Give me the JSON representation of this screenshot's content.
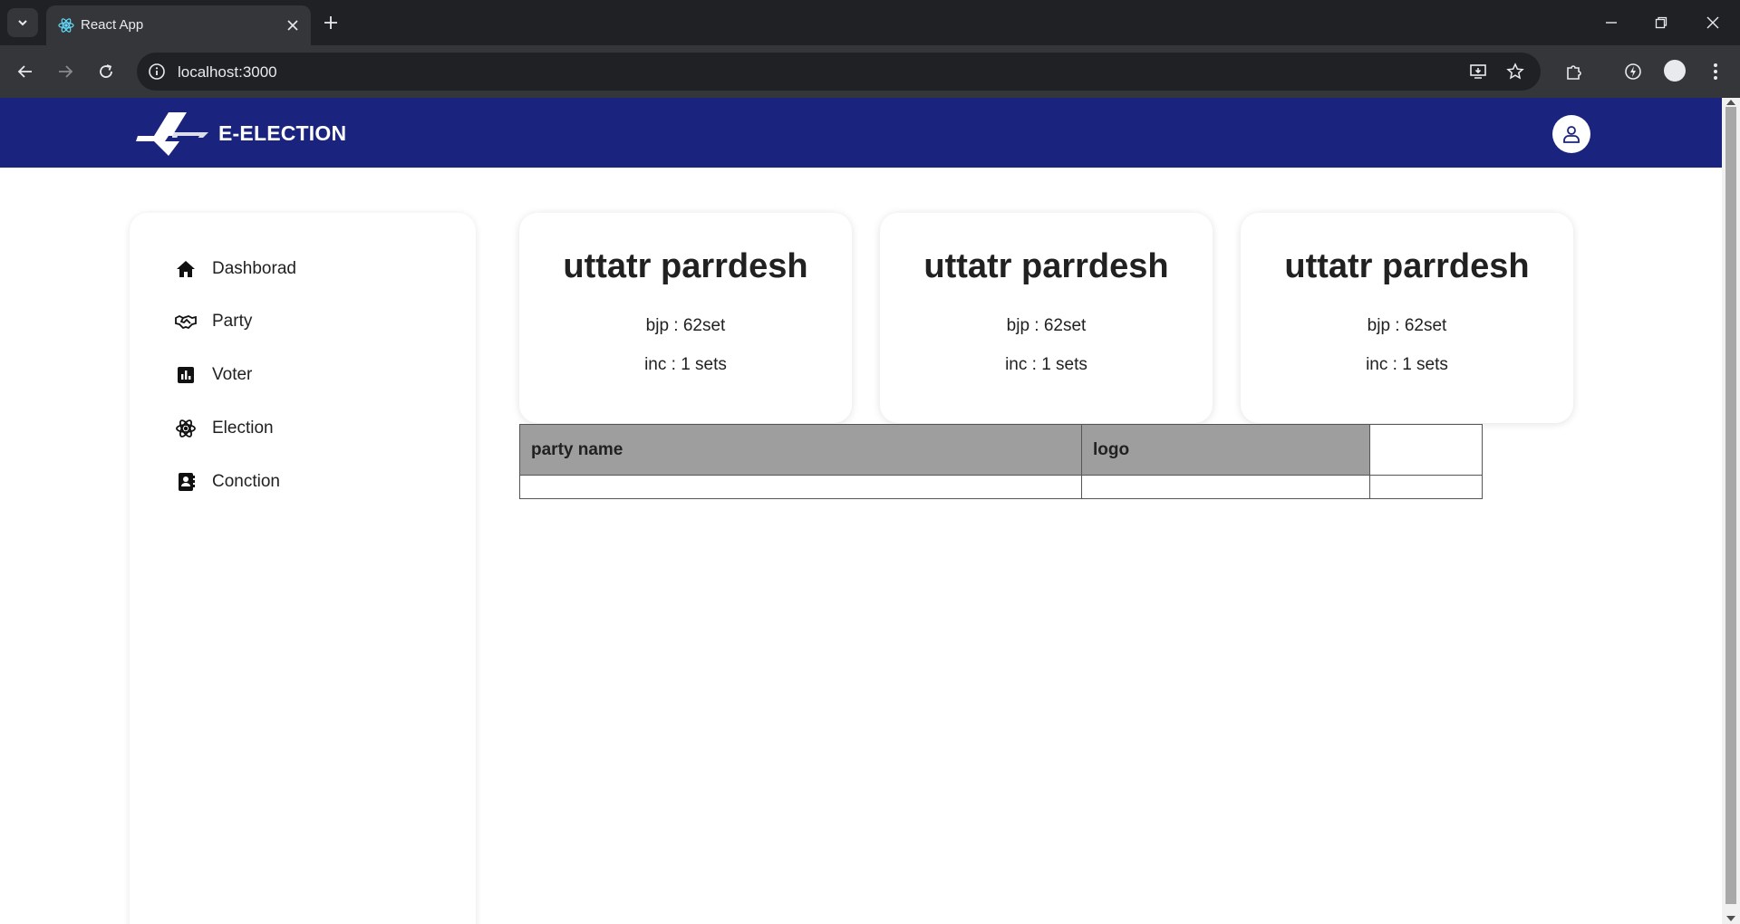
{
  "browser": {
    "tab_title": "React App",
    "url": "localhost:3000"
  },
  "app": {
    "brand": "E-ELECTION",
    "colors": {
      "appbar": "#1a237e",
      "table_header": "#9e9e9e"
    }
  },
  "sidebar": {
    "items": [
      {
        "label": "Dashborad",
        "icon": "home-icon"
      },
      {
        "label": "Party",
        "icon": "handshake-icon"
      },
      {
        "label": "Voter",
        "icon": "bar-chart-icon"
      },
      {
        "label": "Election",
        "icon": "atom-icon"
      },
      {
        "label": "Conction",
        "icon": "contact-book-icon"
      }
    ]
  },
  "cards": [
    {
      "title": "uttatr parrdesh",
      "line1": "bjp : 62set",
      "line2": "inc : 1 sets"
    },
    {
      "title": "uttatr parrdesh",
      "line1": "bjp : 62set",
      "line2": "inc : 1 sets"
    },
    {
      "title": "uttatr parrdesh",
      "line1": "bjp : 62set",
      "line2": "inc : 1 sets"
    }
  ],
  "table": {
    "headers": [
      "party name",
      "logo",
      ""
    ]
  }
}
